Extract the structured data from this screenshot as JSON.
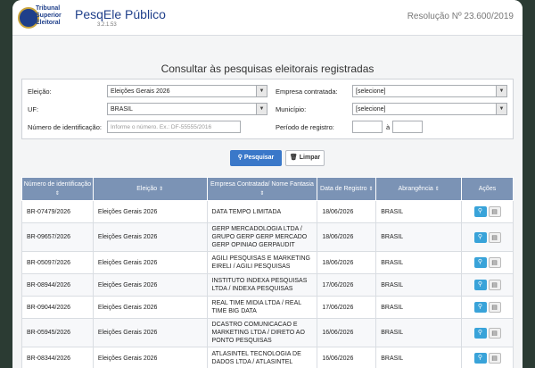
{
  "header": {
    "logo_lines": [
      "Tribunal",
      "Superior",
      "Eleitoral"
    ],
    "app_title": "PesqEle Público",
    "version": "3.2.1.53",
    "resolution": "Resolução Nº 23.600/2019"
  },
  "page_title": "Consultar às pesquisas eleitorais registradas",
  "filters": {
    "eleicao_label": "Eleição:",
    "eleicao_value": "Eleições Gerais 2026",
    "uf_label": "UF:",
    "uf_value": "BRASIL",
    "numero_label": "Número de identificação:",
    "numero_placeholder": "Informe o número. Ex.: DF-55555/2016",
    "empresa_label": "Empresa contratada:",
    "empresa_value": "[selecione]",
    "municipio_label": "Município:",
    "municipio_value": "[selecione]",
    "periodo_label": "Período de registro:",
    "periodo_sep": "à"
  },
  "buttons": {
    "search": "Pesquisar",
    "clear": "Limpar"
  },
  "table": {
    "headers": [
      "Número de identificação",
      "Eleição",
      "Empresa Contratada/ Nome Fantasia",
      "Data de Registro",
      "Abrangência",
      "Ações"
    ],
    "rows": [
      [
        "BR-07479/2026",
        "Eleições Gerais 2026",
        "DATA TEMPO LIMITADA",
        "18/06/2026",
        "BRASIL"
      ],
      [
        "BR-09657/2026",
        "Eleições Gerais 2026",
        "GERP MERCADOLOGIA LTDA / GRUPO GERP GERP MERCADO GERP OPINIAO GERPAUDIT",
        "18/06/2026",
        "BRASIL"
      ],
      [
        "BR-05097/2026",
        "Eleições Gerais 2026",
        "AGILI PESQUISAS E MARKETING EIRELI / AGILI PESQUISAS",
        "18/06/2026",
        "BRASIL"
      ],
      [
        "BR-08944/2026",
        "Eleições Gerais 2026",
        "INSTITUTO INDEXA PESQUISAS LTDA / INDEXA PESQUISAS",
        "17/06/2026",
        "BRASIL"
      ],
      [
        "BR-09044/2026",
        "Eleições Gerais 2026",
        "REAL TIME MIDIA LTDA / REAL TIME BIG DATA",
        "17/06/2026",
        "BRASIL"
      ],
      [
        "BR-05945/2026",
        "Eleições Gerais 2026",
        "DCASTRO COMUNICACAO E MARKETING LTDA / DIRETO AO PONTO PESQUISAS",
        "16/06/2026",
        "BRASIL"
      ],
      [
        "BR-08344/2026",
        "Eleições Gerais 2026",
        "ATLASINTEL TECNOLOGIA DE DADOS LTDA / ATLASINTEL",
        "16/06/2026",
        "BRASIL"
      ]
    ]
  },
  "icons": {
    "search": "search-icon",
    "trash": "trash-icon",
    "view": "magnifier-icon",
    "doc": "document-icon",
    "sort": "sort-icon"
  }
}
